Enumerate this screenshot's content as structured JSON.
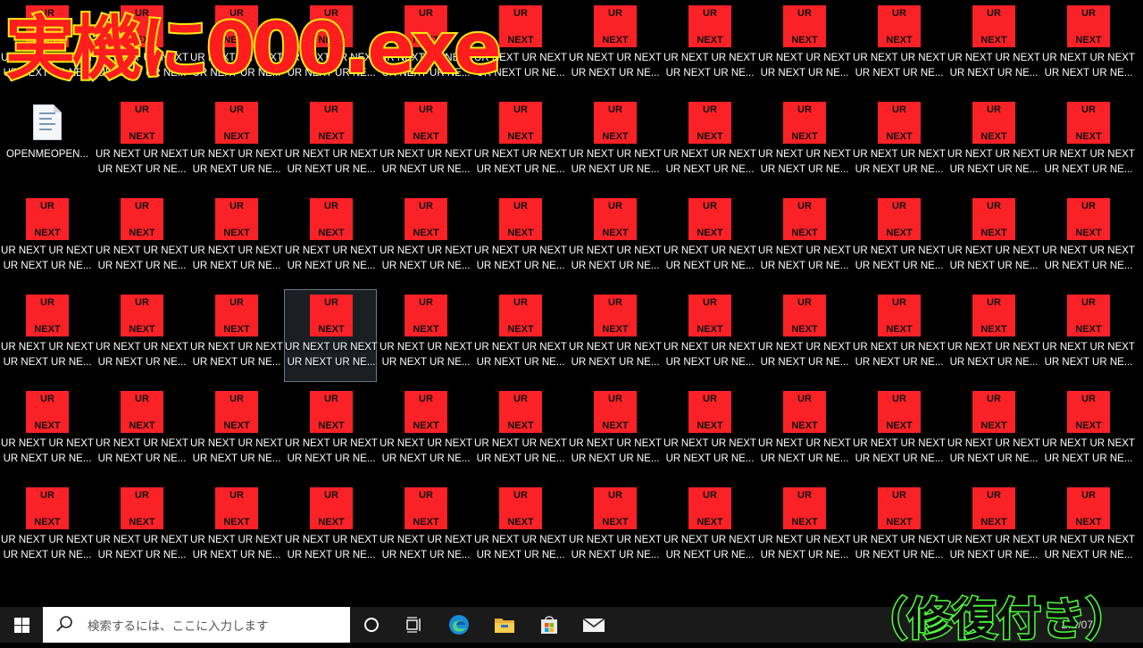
{
  "overlay": {
    "title": "実機に000.exe",
    "repair_note": "（修復付き）"
  },
  "desktop": {
    "icon_text_top": "UR",
    "icon_text_bottom": "NEXT",
    "icon_label": "UR NEXT UR NEXT\nUR NEXT UR NE...",
    "file_label": "OPENMEOPEN...",
    "selected_index": 39,
    "columns": 12,
    "rows": 6,
    "colors": {
      "icon_red": "#fb2227",
      "overlay_red": "#ff1d1d",
      "overlay_yellow": "#fde910",
      "overlay_green": "#4cf93b"
    }
  },
  "taskbar": {
    "search_placeholder": "検索するには、ここに入力します",
    "clock_text": "2…/07",
    "icons": [
      "windows-start-icon",
      "search-icon",
      "cortana-icon",
      "task-view-icon",
      "edge-icon",
      "file-explorer-icon",
      "store-icon",
      "mail-icon"
    ]
  }
}
